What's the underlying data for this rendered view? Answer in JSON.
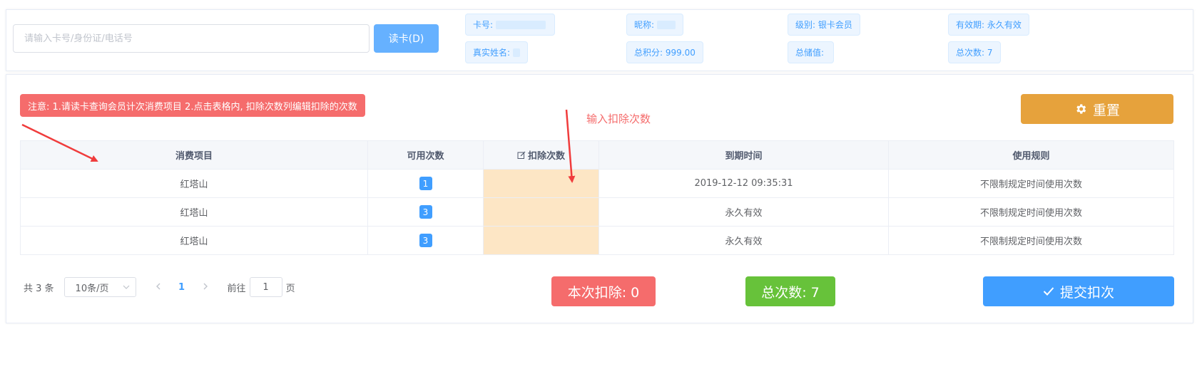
{
  "search": {
    "placeholder": "请输入卡号/身份证/电话号",
    "value": ""
  },
  "read_card_label": "读卡(D)",
  "member": {
    "card_no_label": "卡号:",
    "nickname_label": "昵称:",
    "level_label": "级别: 银卡会员",
    "validity_label": "有效期: 永久有效",
    "real_name_label": "真实姓名:",
    "points_label": "总积分: 999.00",
    "balance_label": "总储值:",
    "total_count_label": "总次数: 7"
  },
  "notice": "注意: 1.请读卡查询会员计次消费项目 2.点击表格内, 扣除次数列编辑扣除的次数",
  "reset_label": "重置",
  "annotation": "输入扣除次数",
  "table": {
    "headers": [
      "消费项目",
      "可用次数",
      "扣除次数",
      "到期时间",
      "使用规则"
    ],
    "rows": [
      {
        "item": "红塔山",
        "available": "1",
        "deduct": "",
        "expire": "2019-12-12 09:35:31",
        "rule": "不限制规定时间使用次数"
      },
      {
        "item": "红塔山",
        "available": "3",
        "deduct": "",
        "expire": "永久有效",
        "rule": "不限制规定时间使用次数"
      },
      {
        "item": "红塔山",
        "available": "3",
        "deduct": "",
        "expire": "永久有效",
        "rule": "不限制规定时间使用次数"
      }
    ]
  },
  "pagination": {
    "total_text": "共 3 条",
    "page_size": "10条/页",
    "current_page": "1",
    "goto_label": "前往",
    "goto_value": "1",
    "page_suffix": "页"
  },
  "summary": {
    "deduct_label": "本次扣除: 0",
    "total_label": "总次数: 7",
    "submit_label": "提交扣次"
  },
  "colors": {
    "primary": "#409eff",
    "danger": "#f56c6c",
    "warning": "#e6a23c",
    "success": "#67c23a",
    "edit_cell": "#fde6c5"
  }
}
